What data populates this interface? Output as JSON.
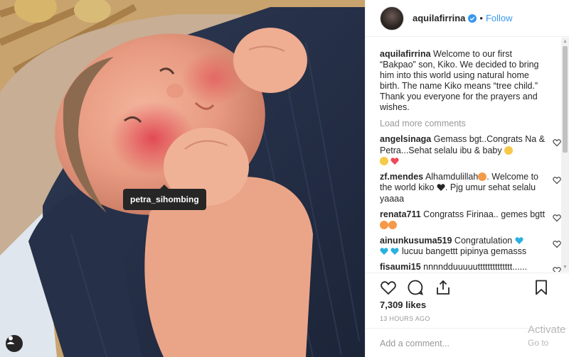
{
  "post": {
    "username": "aquilafirrina",
    "follow_label": "Follow",
    "dot": "•",
    "photo_tag": "petra_sihombing",
    "caption_user": "aquilafirrina",
    "caption_text": "Welcome to our first “Bakpao” son, Kiko. We decided to bring him into this world using natural home birth. The name Kiko means “tree child.” Thank you everyone for the prayers and wishes.",
    "load_more": "Load more comments",
    "likes": "7,309 likes",
    "time": "13 HOURS AGO",
    "add_comment_placeholder": "Add a comment...",
    "more_icon": "..."
  },
  "comments": [
    {
      "user": "angelsinaga",
      "text": "Gemass bgt..Congrats Na & Petra...Sehat selalu ibu & baby"
    },
    {
      "user": "zf.mendes",
      "text": "Alhamdulillah",
      "text2": ". Welcome to the world kiko",
      "text3": ". Pjg umur sehat selalu yaaaa"
    },
    {
      "user": "renata711",
      "text": "Congratss Firinaa.. gemes bgtt"
    },
    {
      "user": "ainunkusuma519",
      "text": "Congratulation",
      "text2": "lucuu bangettt pipinya gemasss"
    },
    {
      "user": "fisaumi15",
      "text": "nnnndduuuuutttttttttttttt...... gemesshhh"
    }
  ],
  "watermark": {
    "line1": "Activate",
    "line2": "Go to"
  },
  "colors": {
    "link": "#3897f0",
    "muted": "#999999",
    "heart_red": "#ed4956",
    "tag_bg": "#262626"
  },
  "icons": [
    "verified-badge-icon",
    "heart-icon",
    "comment-icon",
    "share-icon",
    "bookmark-icon",
    "user-tag-icon",
    "more-icon"
  ]
}
